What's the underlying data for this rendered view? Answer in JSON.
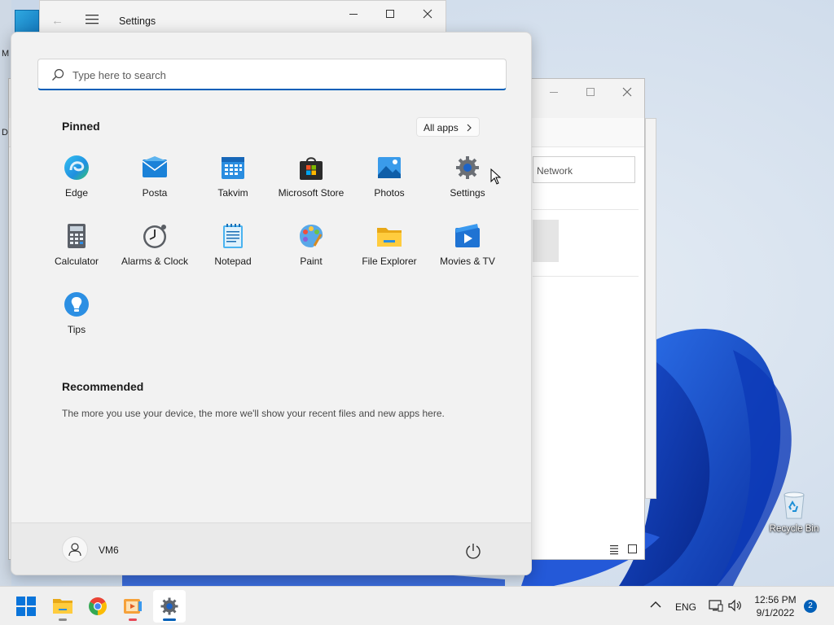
{
  "desktop": {
    "partial_letters": [
      "M",
      "D"
    ],
    "recycle_bin_label": "Recycle Bin"
  },
  "settings_window": {
    "title": "Settings"
  },
  "explorer_window": {
    "address_text": "Network"
  },
  "start_menu": {
    "search": {
      "placeholder": "Type here to search",
      "value": ""
    },
    "pinned": {
      "title": "Pinned",
      "all_apps_label": "All apps",
      "apps": [
        {
          "label": "Edge",
          "icon": "edge-icon"
        },
        {
          "label": "Posta",
          "icon": "mail-icon"
        },
        {
          "label": "Takvim",
          "icon": "calendar-icon"
        },
        {
          "label": "Microsoft Store",
          "icon": "store-icon"
        },
        {
          "label": "Photos",
          "icon": "photos-icon"
        },
        {
          "label": "Settings",
          "icon": "settings-gear-icon"
        },
        {
          "label": "Calculator",
          "icon": "calculator-icon"
        },
        {
          "label": "Alarms & Clock",
          "icon": "clock-icon"
        },
        {
          "label": "Notepad",
          "icon": "notepad-icon"
        },
        {
          "label": "Paint",
          "icon": "paint-icon"
        },
        {
          "label": "File Explorer",
          "icon": "folder-icon"
        },
        {
          "label": "Movies & TV",
          "icon": "movies-icon"
        },
        {
          "label": "Tips",
          "icon": "tips-icon"
        }
      ]
    },
    "recommended": {
      "title": "Recommended",
      "empty_text": "The more you use your device, the more we'll show your recent files and new apps here."
    },
    "user": {
      "name": "VM6"
    }
  },
  "taskbar": {
    "apps": [
      {
        "name": "start-button",
        "icon": "windows-logo-icon"
      },
      {
        "name": "file-explorer",
        "icon": "folder-icon",
        "running": true
      },
      {
        "name": "chrome",
        "icon": "chrome-icon"
      },
      {
        "name": "media-app",
        "icon": "media-player-icon",
        "running": true,
        "alert": true
      },
      {
        "name": "settings",
        "icon": "settings-gear-icon",
        "running": true,
        "active": true
      }
    ],
    "tray": {
      "language": "ENG",
      "time": "12:56 PM",
      "date": "9/1/2022",
      "notification_count": "2"
    }
  },
  "colors": {
    "accent": "#005fb8",
    "wallpaper_blue": "#1f54c6",
    "start_bg": "#f2f2f2"
  }
}
